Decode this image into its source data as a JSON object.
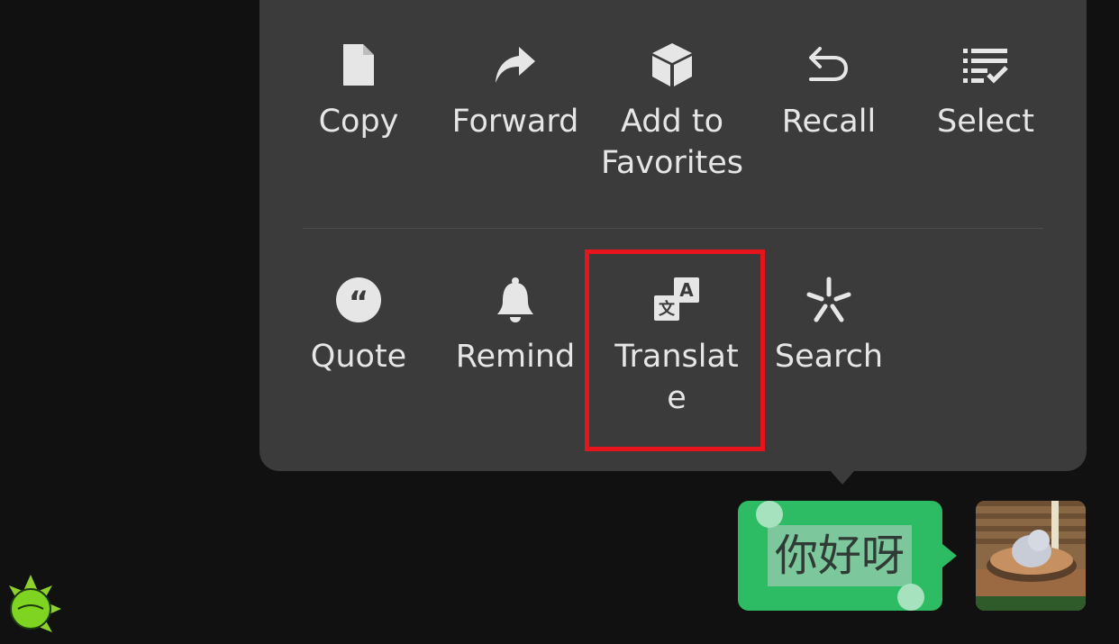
{
  "menu": {
    "row1": [
      {
        "label": "Copy",
        "icon": "document-icon"
      },
      {
        "label": "Forward",
        "icon": "forward-arrow-icon"
      },
      {
        "label": "Add to\nFavorites",
        "icon": "cube-icon"
      },
      {
        "label": "Recall",
        "icon": "undo-arrow-icon"
      },
      {
        "label": "Select",
        "icon": "checklist-icon"
      }
    ],
    "row2": [
      {
        "label": "Quote",
        "icon": "quote-icon"
      },
      {
        "label": "Remind",
        "icon": "bell-icon"
      },
      {
        "label": "Translat\ne",
        "icon": "translate-icon"
      },
      {
        "label": "Search",
        "icon": "sparkle-search-icon"
      }
    ]
  },
  "message": {
    "text": "你好呀"
  },
  "colors": {
    "background": "#111111",
    "menu_bg": "#3b3b3b",
    "bubble_green": "#2dbb63",
    "highlight_red": "#e8141b"
  }
}
